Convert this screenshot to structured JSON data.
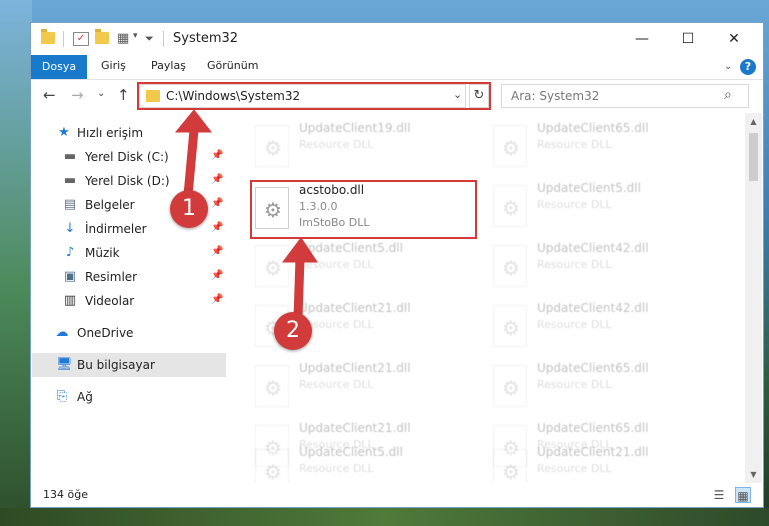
{
  "window": {
    "title": "System32"
  },
  "ribbon": {
    "tabs": [
      "Dosya",
      "Giriş",
      "Paylaş",
      "Görünüm"
    ],
    "help": "?"
  },
  "nav": {
    "address": "C:\\Windows\\System32",
    "search_placeholder": "Ara: System32"
  },
  "sidebar": {
    "items": [
      {
        "label": "Hızlı erişim",
        "icon": "star-icon",
        "pinned": false
      },
      {
        "label": "Yerel Disk (C:)",
        "icon": "drive-icon",
        "pinned": true
      },
      {
        "label": "Yerel Disk (D:)",
        "icon": "drive-icon",
        "pinned": true
      },
      {
        "label": "Belgeler",
        "icon": "documents-icon",
        "pinned": true
      },
      {
        "label": "İndirmeler",
        "icon": "download-icon",
        "pinned": true
      },
      {
        "label": "Müzik",
        "icon": "music-icon",
        "pinned": true
      },
      {
        "label": "Resimler",
        "icon": "pictures-icon",
        "pinned": true
      },
      {
        "label": "Videolar",
        "icon": "videos-icon",
        "pinned": true
      },
      {
        "label": "OneDrive",
        "icon": "cloud-icon",
        "pinned": false
      },
      {
        "label": "Bu bilgisayar",
        "icon": "computer-icon",
        "pinned": false
      },
      {
        "label": "Ağ",
        "icon": "network-icon",
        "pinned": false
      }
    ]
  },
  "files": {
    "selected": {
      "name": "acstobo.dll",
      "version": "1.3.0.0",
      "description": "ImStoBo DLL"
    },
    "left_column": [
      {
        "name": "UpdateClient19.dll",
        "type": "Resource DLL"
      },
      {
        "name": "UpdateClient5.dll",
        "type": "Resource DLL"
      },
      {
        "name": "UpdateClient21.dll",
        "type": "Resource DLL"
      },
      {
        "name": "UpdateClient21.dll",
        "type": "Resource DLL"
      },
      {
        "name": "UpdateClient21.dll",
        "type": "Resource DLL"
      },
      {
        "name": "UpdateClient5.dll",
        "type": "Resource DLL"
      }
    ],
    "right_column": [
      {
        "name": "UpdateClient65.dll",
        "type": "Resource DLL"
      },
      {
        "name": "UpdateClient5.dll",
        "type": "Resource DLL"
      },
      {
        "name": "UpdateClient42.dll",
        "type": "Resource DLL"
      },
      {
        "name": "UpdateClient42.dll",
        "type": "Resource DLL"
      },
      {
        "name": "UpdateClient65.dll",
        "type": "Resource DLL"
      },
      {
        "name": "UpdateClient65.dll",
        "type": "Resource DLL"
      },
      {
        "name": "UpdateClient21.dll",
        "type": "Resource DLL"
      }
    ]
  },
  "status": {
    "item_count": "134 öğe"
  },
  "annotations": {
    "step1": "1",
    "step2": "2",
    "color": "#d23b3b"
  }
}
